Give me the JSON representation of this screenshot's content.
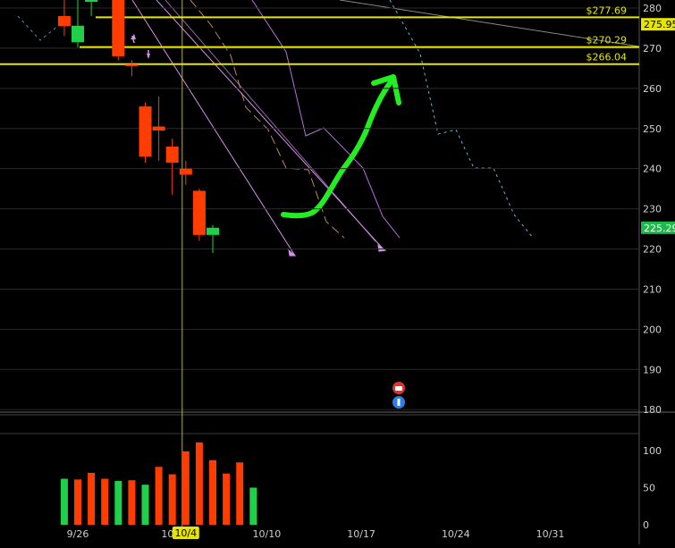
{
  "chart_data": [
    {
      "type": "candlestick",
      "x_ticks": [
        {
          "label": "9/26",
          "day": 0
        },
        {
          "label": "10/3",
          "day": 7
        },
        {
          "label": "10/4",
          "day": 8,
          "highlight": true
        },
        {
          "label": "10/10",
          "day": 14
        },
        {
          "label": "10/17",
          "day": 21
        },
        {
          "label": "10/24",
          "day": 28
        },
        {
          "label": "10/31",
          "day": 35
        }
      ],
      "y_ticks": [
        280,
        270,
        260,
        250,
        240,
        230,
        220,
        210,
        200,
        190,
        180
      ],
      "ylim": [
        178,
        282
      ],
      "candles": [
        {
          "day": -1,
          "open": 278.0,
          "high": 282.0,
          "low": 273.0,
          "close": 275.5
        },
        {
          "day": 0,
          "open": 271.5,
          "high": 282.0,
          "low": 270.2,
          "close": 275.6
        },
        {
          "day": 1,
          "open": 282.0,
          "high": 285.0,
          "low": 278.0,
          "close": 282.0
        },
        {
          "day": 3,
          "open": 282.0,
          "high": 283.0,
          "low": 267.0,
          "close": 268.0
        },
        {
          "day": 4,
          "open": 266.0,
          "high": 267.0,
          "low": 263.0,
          "close": 265.5
        },
        {
          "day": 5,
          "open": 255.5,
          "high": 256.5,
          "low": 241.5,
          "close": 243.0
        },
        {
          "day": 6,
          "open": 250.5,
          "high": 258.0,
          "low": 242.0,
          "close": 249.5
        },
        {
          "day": 7,
          "open": 245.5,
          "high": 247.5,
          "low": 233.5,
          "close": 241.5
        },
        {
          "day": 8,
          "open": 240.0,
          "high": 242.0,
          "low": 236.0,
          "close": 238.5
        },
        {
          "day": 9,
          "open": 234.5,
          "high": 235.0,
          "low": 222.0,
          "close": 223.5
        },
        {
          "day": 10,
          "open": 223.5,
          "high": 226.0,
          "low": 219.0,
          "close": 225.29
        }
      ],
      "price_levels": [
        {
          "label": "$277.69",
          "value": 277.69,
          "color": "#e6e600"
        },
        {
          "label": "$270.29",
          "value": 270.29,
          "color": "#e6e600"
        },
        {
          "label": "$266.04",
          "value": 266.04,
          "color": "#e6e600"
        }
      ],
      "axis_flags": [
        {
          "label": "275.95",
          "value": 275.95,
          "color": "#e6e600",
          "text_color": "#000000"
        },
        {
          "label": "225.29",
          "value": 225.29,
          "color": "#1fb84a",
          "text_color": "#ffffff"
        }
      ],
      "colors": {
        "up": "#1fd14a",
        "down": "#ff3d00",
        "level": "#e6e600",
        "arrow": "#22ee22",
        "trendline": "#d98ff0",
        "forecast": "#5fb8d8",
        "grid": "#2a2a2a"
      }
    },
    {
      "type": "bar",
      "y_ticks": [
        100,
        50,
        0
      ],
      "ylim": [
        0,
        125
      ],
      "bars": [
        {
          "day": -1,
          "value": 62,
          "color": "green"
        },
        {
          "day": 0,
          "value": 61,
          "color": "red"
        },
        {
          "day": 1,
          "value": 70,
          "color": "red"
        },
        {
          "day": 2,
          "value": 62,
          "color": "red"
        },
        {
          "day": 3,
          "value": 59,
          "color": "green"
        },
        {
          "day": 4,
          "value": 60,
          "color": "red"
        },
        {
          "day": 5,
          "value": 54,
          "color": "green"
        },
        {
          "day": 6,
          "value": 78,
          "color": "red"
        },
        {
          "day": 7,
          "value": 68,
          "color": "red"
        },
        {
          "day": 8,
          "value": 99,
          "color": "red"
        },
        {
          "day": 9,
          "value": 111,
          "color": "red"
        },
        {
          "day": 10,
          "value": 87,
          "color": "red"
        },
        {
          "day": 11,
          "value": 69,
          "color": "red"
        },
        {
          "day": 12,
          "value": 84,
          "color": "red"
        },
        {
          "day": 13,
          "value": 50,
          "color": "green"
        }
      ]
    }
  ],
  "event_icons": [
    {
      "icon": "earnings-icon",
      "color": "#e03030"
    },
    {
      "icon": "info-icon",
      "color": "#2a7fe0"
    }
  ]
}
